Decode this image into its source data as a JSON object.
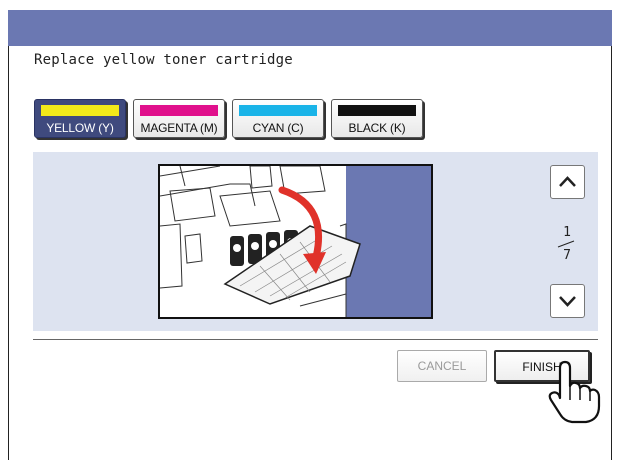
{
  "title": "Replace yellow toner cartridge",
  "toner_buttons": [
    {
      "label": "YELLOW (Y)",
      "swatch_color": "#f2ea1a",
      "active": true
    },
    {
      "label": "MAGENTA (M)",
      "swatch_color": "#e0108c",
      "active": false
    },
    {
      "label": "CYAN (C)",
      "swatch_color": "#1ab4e8",
      "active": false
    },
    {
      "label": "BLACK (K)",
      "swatch_color": "#111111",
      "active": false
    }
  ],
  "pagination": {
    "current": "1",
    "total": "7"
  },
  "actions": {
    "cancel_label": "CANCEL",
    "finish_label": "FINISH"
  },
  "colors": {
    "header": "#6b78b2",
    "panel": "#dde3f0",
    "accent_arrow": "#e0322a"
  }
}
